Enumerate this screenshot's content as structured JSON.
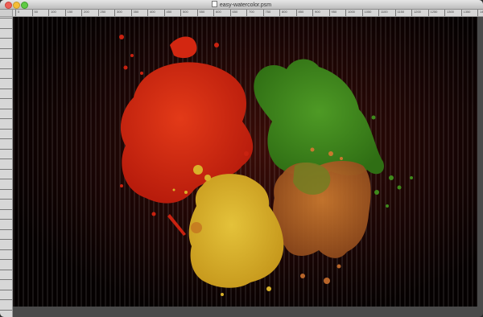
{
  "window": {
    "title": "easy-watercolor.psm"
  },
  "icons": [
    "close-icon",
    "minimize-icon",
    "zoom-icon",
    "document-icon"
  ],
  "ruler": {
    "labels": [
      "0",
      "50",
      "100",
      "150",
      "200",
      "250",
      "300",
      "350",
      "400",
      "450",
      "500",
      "550",
      "600",
      "650",
      "700",
      "750",
      "800",
      "850",
      "900",
      "950",
      "1000",
      "1050",
      "1100",
      "1150",
      "1200",
      "1250",
      "1300",
      "1350",
      "1400"
    ]
  },
  "colors": {
    "background": "#0b0303",
    "red": "#d32711",
    "green": "#3f8a1c",
    "yellow": "#d9b12a",
    "orange": "#b8652a"
  }
}
